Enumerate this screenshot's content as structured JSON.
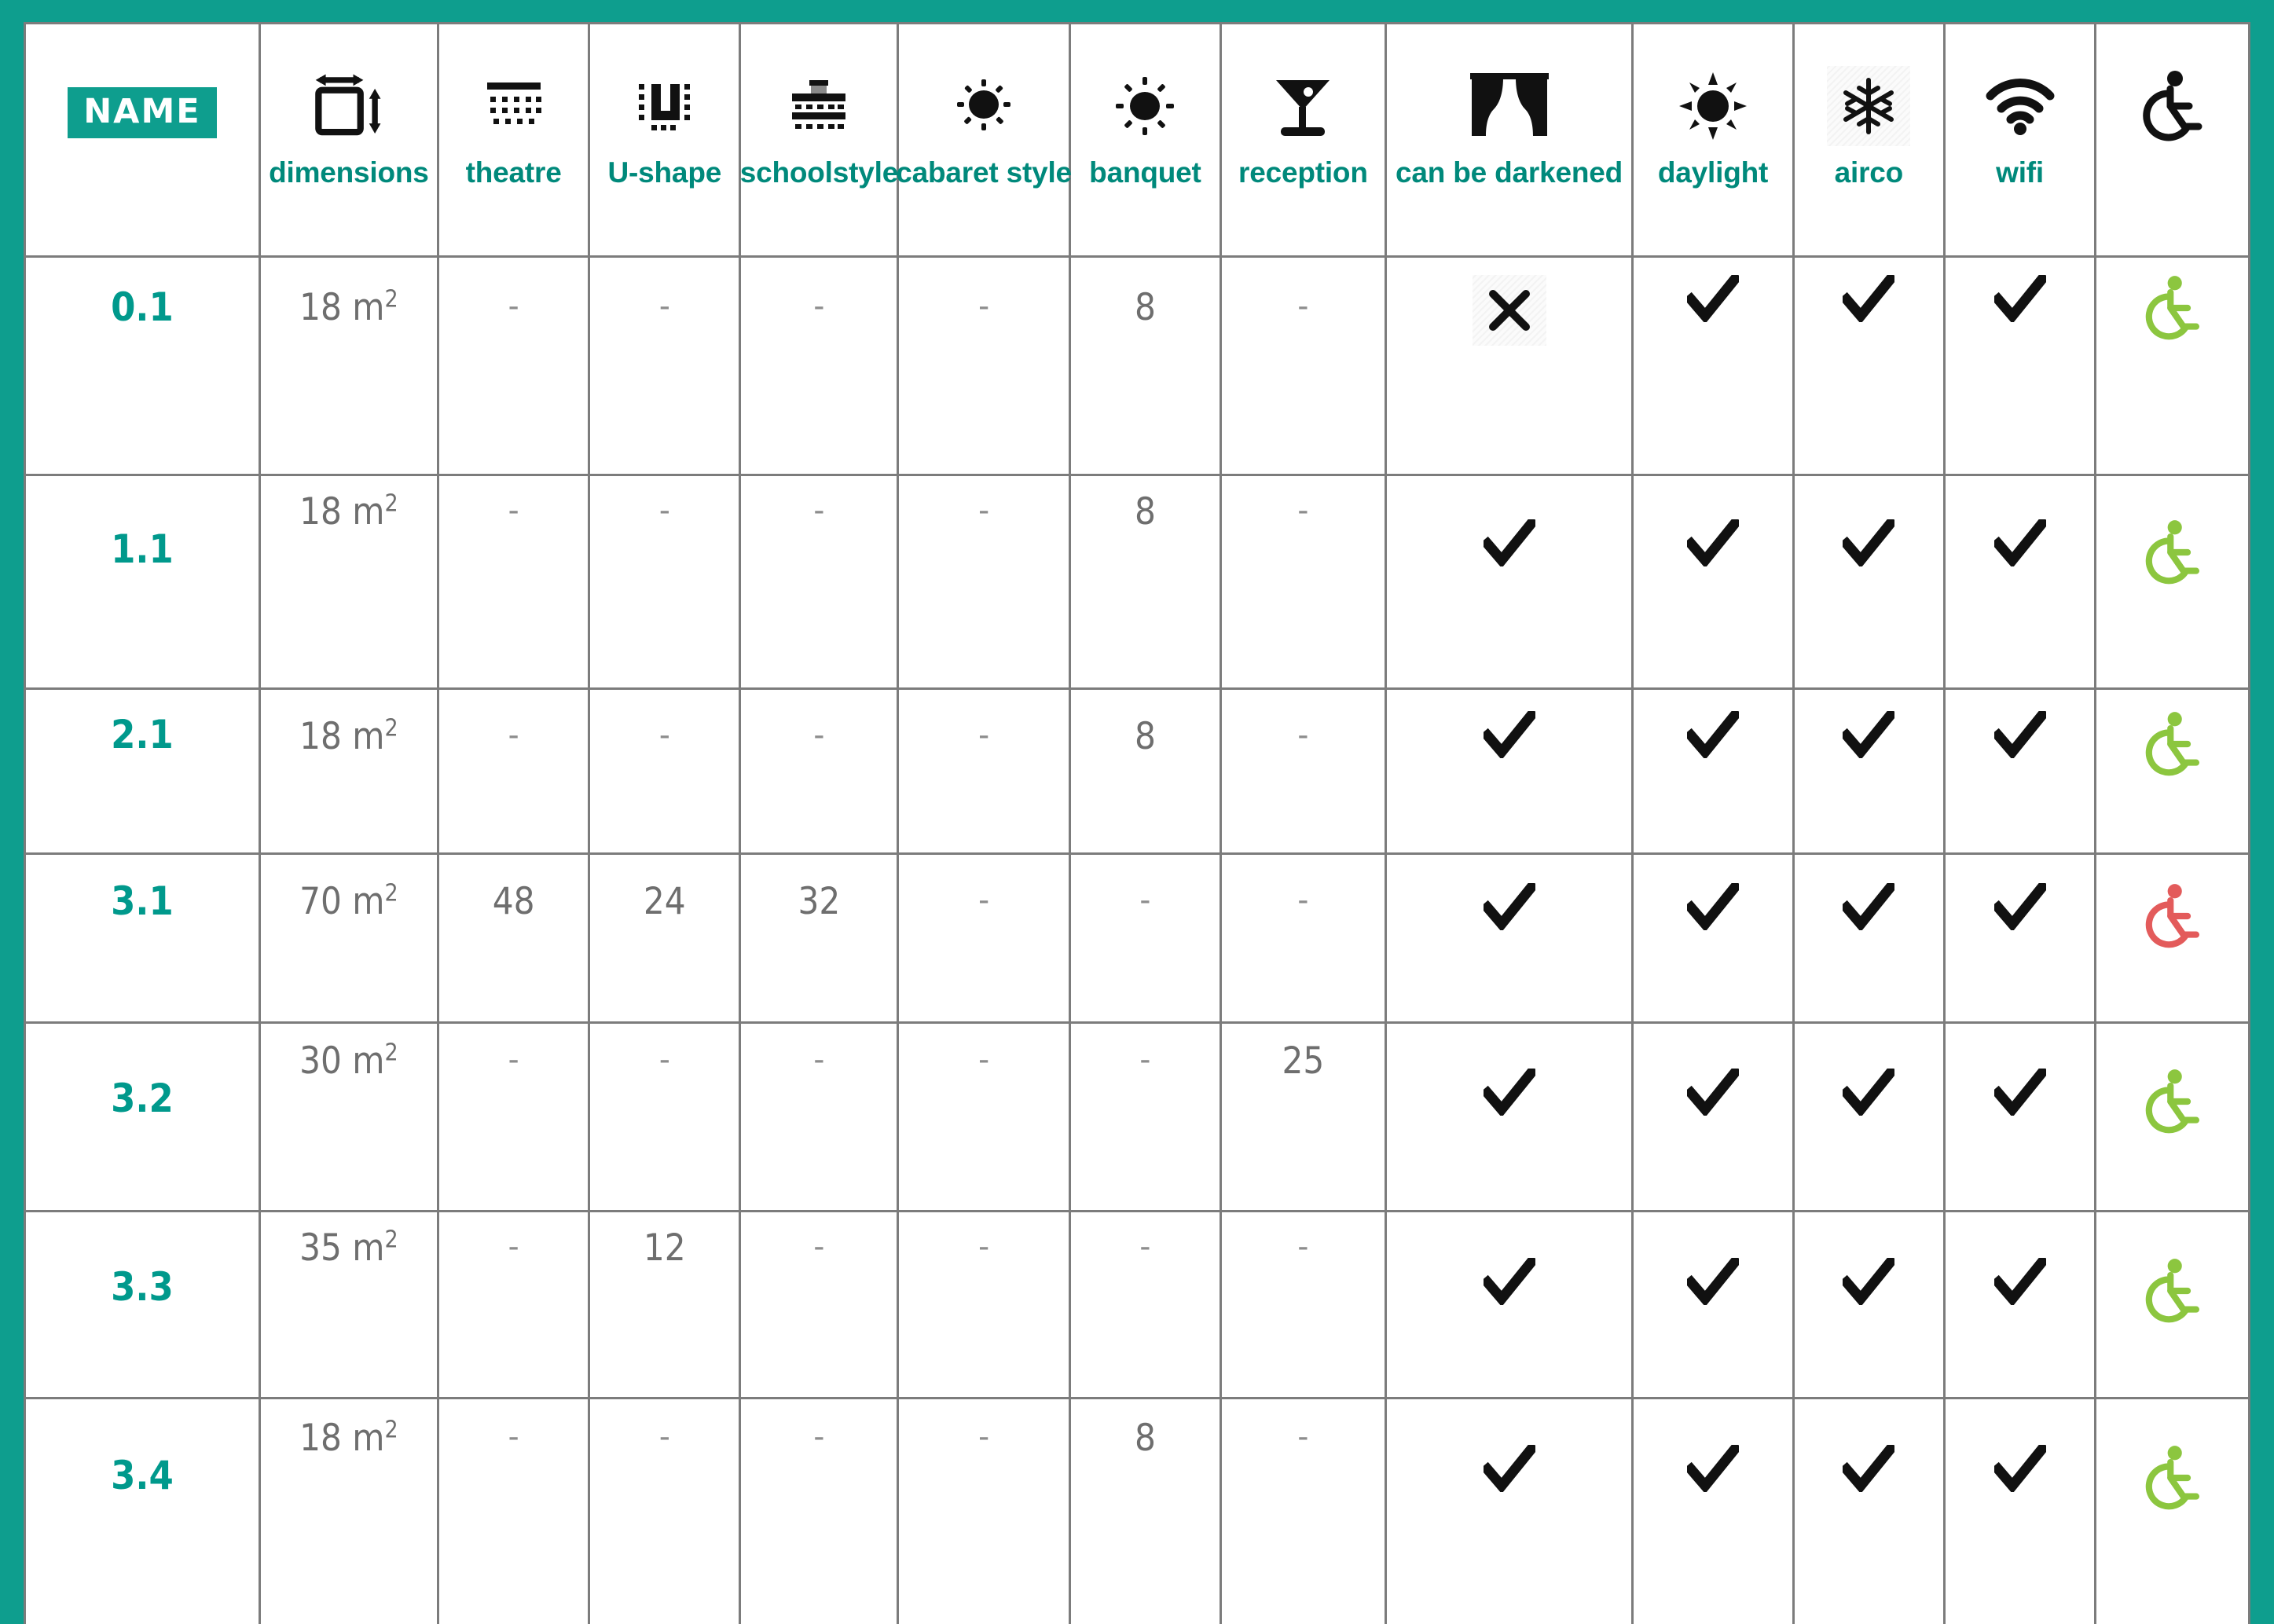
{
  "theme": {
    "brand_teal": "#0E9E8E",
    "label_teal": "#00897B",
    "value_grey": "#6e6e6e",
    "grid_grey": "#7c7c7c",
    "access_yes_green": "#8CC63F",
    "access_no_red": "#E35B5B"
  },
  "header": {
    "name_badge": "NAME",
    "columns": [
      {
        "key": "name",
        "icon": "name-badge",
        "label": ""
      },
      {
        "key": "dimensions",
        "icon": "dimensions-icon",
        "label": "dimensions"
      },
      {
        "key": "theatre",
        "icon": "theatre-icon",
        "label": "theatre"
      },
      {
        "key": "ushape",
        "icon": "u-shape-icon",
        "label": "U-shape"
      },
      {
        "key": "schoolstyle",
        "icon": "schoolstyle-icon",
        "label": "schoolstyle"
      },
      {
        "key": "cabaret",
        "icon": "cabaret-style-icon",
        "label": "cabaret style"
      },
      {
        "key": "banquet",
        "icon": "banquet-icon",
        "label": "banquet"
      },
      {
        "key": "reception",
        "icon": "cocktail-glass-icon",
        "label": "reception"
      },
      {
        "key": "darkened",
        "icon": "curtain-icon",
        "label": "can be darkened"
      },
      {
        "key": "daylight",
        "icon": "sun-icon",
        "label": "daylight"
      },
      {
        "key": "airco",
        "icon": "snowflake-icon",
        "label": "airco"
      },
      {
        "key": "wifi",
        "icon": "wifi-icon",
        "label": "wifi"
      },
      {
        "key": "accessible",
        "icon": "wheelchair-icon",
        "label": ""
      }
    ]
  },
  "rows": [
    {
      "name": "0.1",
      "dimensions": "18 m",
      "dimensions_sup": "2",
      "theatre": "-",
      "ushape": "-",
      "schoolstyle": "-",
      "cabaret": "-",
      "banquet": "8",
      "reception": "-",
      "darkened": "cross",
      "daylight": "check",
      "airco": "check",
      "wifi": "check",
      "accessible": "yes"
    },
    {
      "name": "1.1",
      "dimensions": "18 m",
      "dimensions_sup": "2",
      "theatre": "-",
      "ushape": "-",
      "schoolstyle": "-",
      "cabaret": "-",
      "banquet": "8",
      "reception": "-",
      "darkened": "check",
      "daylight": "check",
      "airco": "check",
      "wifi": "check",
      "accessible": "yes"
    },
    {
      "name": "2.1",
      "dimensions": "18 m",
      "dimensions_sup": "2",
      "theatre": "-",
      "ushape": "-",
      "schoolstyle": "-",
      "cabaret": "-",
      "banquet": "8",
      "reception": "-",
      "darkened": "check",
      "daylight": "check",
      "airco": "check",
      "wifi": "check",
      "accessible": "yes"
    },
    {
      "name": "3.1",
      "dimensions": "70 m",
      "dimensions_sup": "2",
      "theatre": "48",
      "ushape": "24",
      "schoolstyle": "32",
      "cabaret": "-",
      "banquet": "-",
      "reception": "-",
      "darkened": "check",
      "daylight": "check",
      "airco": "check",
      "wifi": "check",
      "accessible": "no"
    },
    {
      "name": "3.2",
      "dimensions": "30 m",
      "dimensions_sup": "2",
      "theatre": "-",
      "ushape": "-",
      "schoolstyle": "-",
      "cabaret": "-",
      "banquet": "-",
      "reception": "25",
      "darkened": "check",
      "daylight": "check",
      "airco": "check",
      "wifi": "check",
      "accessible": "yes"
    },
    {
      "name": "3.3",
      "dimensions": "35 m",
      "dimensions_sup": "2",
      "theatre": "-",
      "ushape": "12",
      "schoolstyle": "-",
      "cabaret": "-",
      "banquet": "-",
      "reception": "-",
      "darkened": "check",
      "daylight": "check",
      "airco": "check",
      "wifi": "check",
      "accessible": "yes"
    },
    {
      "name": "3.4",
      "dimensions": "18 m",
      "dimensions_sup": "2",
      "theatre": "-",
      "ushape": "-",
      "schoolstyle": "-",
      "cabaret": "-",
      "banquet": "8",
      "reception": "-",
      "darkened": "check",
      "daylight": "check",
      "airco": "check",
      "wifi": "check",
      "accessible": "yes"
    }
  ]
}
